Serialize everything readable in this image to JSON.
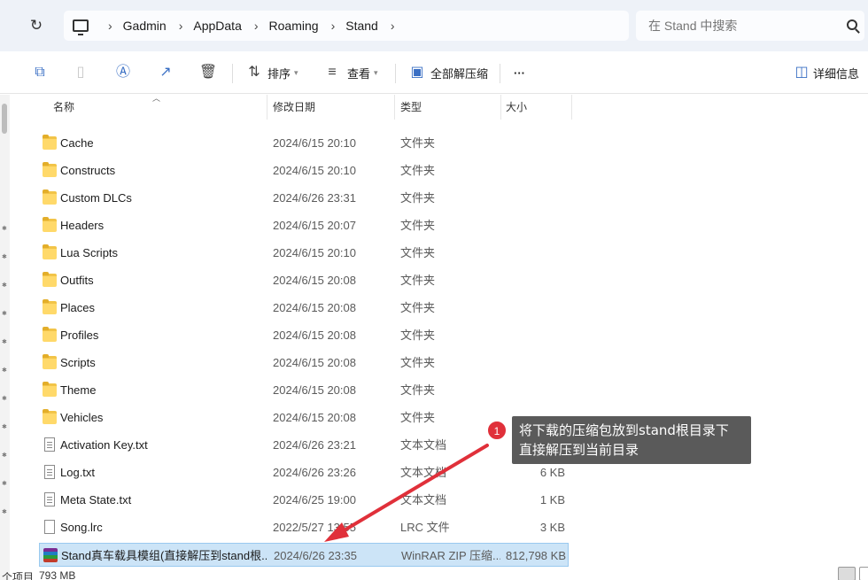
{
  "address_bar": {
    "breadcrumb": [
      "Gadmin",
      "AppData",
      "Roaming",
      "Stand"
    ],
    "search_placeholder": "在 Stand 中搜索"
  },
  "toolbar": {
    "sort_label": "排序",
    "view_label": "查看",
    "extract_label": "全部解压缩",
    "more_label": "···",
    "details_label": "详细信息"
  },
  "columns": {
    "name": "名称",
    "date": "修改日期",
    "type": "类型",
    "size": "大小"
  },
  "rows": [
    {
      "name": "Cache",
      "date": "2024/6/15 20:10",
      "type": "文件夹",
      "size": "",
      "icon": "folder"
    },
    {
      "name": "Constructs",
      "date": "2024/6/15 20:10",
      "type": "文件夹",
      "size": "",
      "icon": "folder"
    },
    {
      "name": "Custom DLCs",
      "date": "2024/6/26 23:31",
      "type": "文件夹",
      "size": "",
      "icon": "folder"
    },
    {
      "name": "Headers",
      "date": "2024/6/15 20:07",
      "type": "文件夹",
      "size": "",
      "icon": "folder"
    },
    {
      "name": "Lua Scripts",
      "date": "2024/6/15 20:10",
      "type": "文件夹",
      "size": "",
      "icon": "folder"
    },
    {
      "name": "Outfits",
      "date": "2024/6/15 20:08",
      "type": "文件夹",
      "size": "",
      "icon": "folder"
    },
    {
      "name": "Places",
      "date": "2024/6/15 20:08",
      "type": "文件夹",
      "size": "",
      "icon": "folder"
    },
    {
      "name": "Profiles",
      "date": "2024/6/15 20:08",
      "type": "文件夹",
      "size": "",
      "icon": "folder"
    },
    {
      "name": "Scripts",
      "date": "2024/6/15 20:08",
      "type": "文件夹",
      "size": "",
      "icon": "folder"
    },
    {
      "name": "Theme",
      "date": "2024/6/15 20:08",
      "type": "文件夹",
      "size": "",
      "icon": "folder"
    },
    {
      "name": "Vehicles",
      "date": "2024/6/15 20:08",
      "type": "文件夹",
      "size": "",
      "icon": "folder"
    },
    {
      "name": "Activation Key.txt",
      "date": "2024/6/26 23:21",
      "type": "文本文档",
      "size": "",
      "icon": "text-doc"
    },
    {
      "name": "Log.txt",
      "date": "2024/6/26 23:26",
      "type": "文本文档",
      "size": "6 KB",
      "icon": "text-doc"
    },
    {
      "name": "Meta State.txt",
      "date": "2024/6/25 19:00",
      "type": "文本文档",
      "size": "1 KB",
      "icon": "text-doc"
    },
    {
      "name": "Song.lrc",
      "date": "2022/5/27 13:55",
      "type": "LRC 文件",
      "size": "3 KB",
      "icon": "blank-doc"
    },
    {
      "name": "Stand真车载具模组(直接解压到stand根...",
      "date": "2024/6/26 23:35",
      "type": "WinRAR ZIP 压缩...",
      "size": "812,798 KB",
      "icon": "winrar",
      "selected": true
    }
  ],
  "status_bar": {
    "item_count": "个项目",
    "selected_size": "793 MB"
  },
  "annotation": {
    "badge": "1",
    "line1": "将下载的压缩包放到stand根目录下",
    "line2": "直接解压到当前目录",
    "color": "#e0303a"
  }
}
